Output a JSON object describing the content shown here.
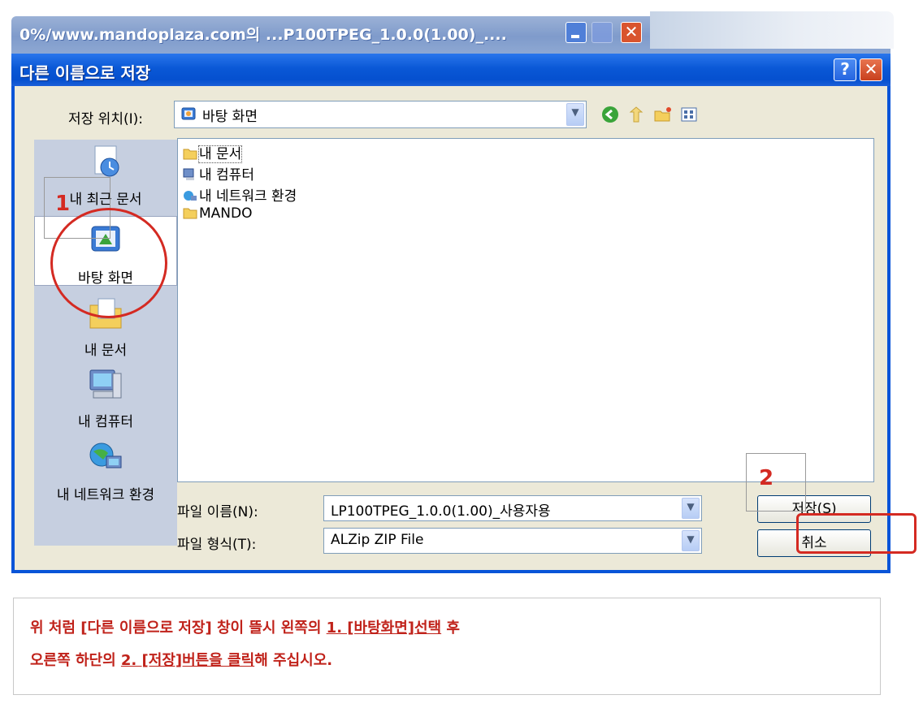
{
  "background_window": {
    "title": "0%/www.mandoplaza.com의 ...P100TPEG_1.0.0(1.00)_...."
  },
  "dialog": {
    "title": "다른 이름으로 저장",
    "help_label": "?",
    "save_in_label": "저장 위치(I):",
    "save_in_value": "바탕 화면",
    "places": [
      {
        "label": "내 최근 문서"
      },
      {
        "label": "바탕 화면"
      },
      {
        "label": "내 문서"
      },
      {
        "label": "내 컴퓨터"
      },
      {
        "label": "내 네트워크 환경"
      }
    ],
    "files": [
      {
        "name": "내 문서"
      },
      {
        "name": "내 컴퓨터"
      },
      {
        "name": "내 네트워크 환경"
      },
      {
        "name": "MANDO"
      }
    ],
    "filename_label": "파일 이름(N):",
    "filename_value": "LP100TPEG_1.0.0(1.00)_사용자용",
    "filetype_label": "파일 형식(T):",
    "filetype_value": "ALZip ZIP File",
    "save_button": "저장(S)",
    "cancel_button": "취소"
  },
  "annotations": {
    "step1": "1",
    "step2": "2",
    "accent_color": "#d42a22"
  },
  "note": {
    "line1_pre": "위 처럼 [다른 이름으로 저장] 창이 뜰시 왼쪽의 ",
    "line1_link": "1. [바탕화면]선택",
    "line1_post": " 후",
    "line2_pre": "오른쪽 하단의 ",
    "line2_link": "2. [저장]버튼을 클릭",
    "line2_post": "해 주십시오."
  }
}
